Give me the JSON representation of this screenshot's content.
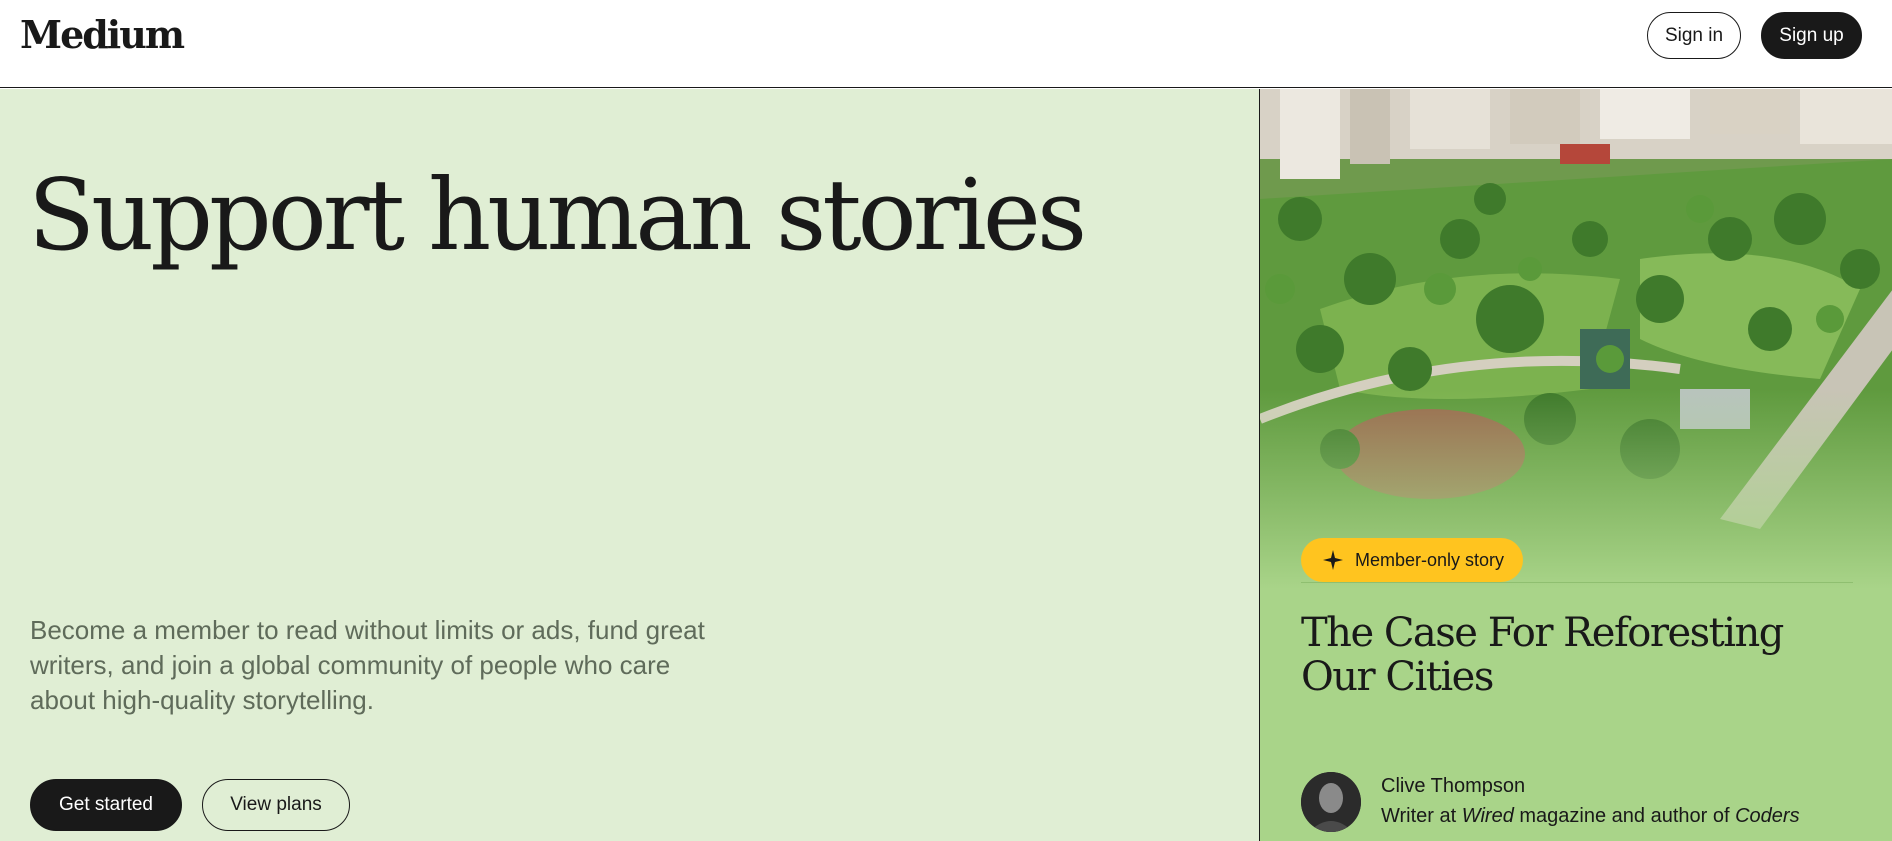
{
  "header": {
    "logo": "Medium",
    "signin_label": "Sign in",
    "signup_label": "Sign up"
  },
  "hero": {
    "title": "Support human stories",
    "subtitle": "Become a member to read without limits or ads, fund great writers, and join a global community of people who care about high-quality storytelling.",
    "get_started_label": "Get started",
    "view_plans_label": "View plans"
  },
  "featured_story": {
    "badge_icon": "sparkle-icon",
    "badge_label": "Member-only story",
    "title": "The Case For Reforesting Our Cities",
    "author": {
      "name": "Clive Thompson",
      "bio_prefix": "Writer at ",
      "bio_publication": "Wired",
      "bio_middle": " magazine and author of ",
      "bio_book": "Coders"
    }
  },
  "colors": {
    "hero_bg": "#e0eed4",
    "card_bg": "#a9d489",
    "badge_bg": "#ffc41f",
    "text": "#191919",
    "subtitle": "#5f6b5a"
  }
}
